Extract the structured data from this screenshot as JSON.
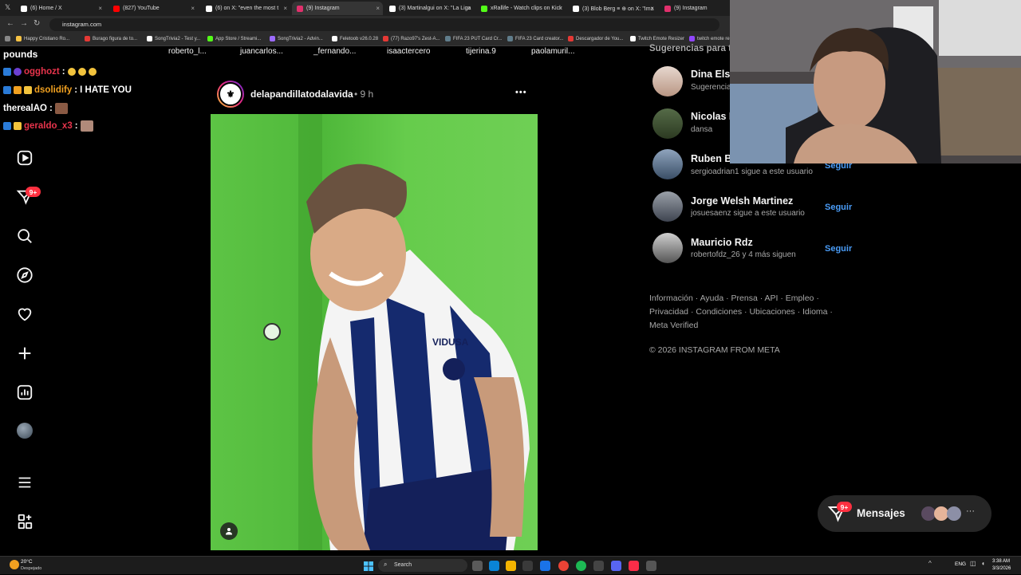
{
  "browser": {
    "tabs": [
      {
        "title": "(6) Home / X",
        "icon": "x-icon",
        "color": "#ffffff"
      },
      {
        "title": "(827) YouTube",
        "icon": "youtube-icon",
        "color": "#ff0000"
      },
      {
        "title": "(6) on X: \"even the most t",
        "icon": "x-icon",
        "color": "#ffffff"
      },
      {
        "title": "(9) Instagram",
        "icon": "instagram-icon",
        "color": "#e1306c"
      },
      {
        "title": "(3) Martinalgui on X: \"La Liga",
        "icon": "x-icon",
        "color": "#ffffff"
      },
      {
        "title": "xRallife - Watch clips on Kick",
        "icon": "kick-icon",
        "color": "#53fc18"
      },
      {
        "title": "(3) Blob Berg ≡ ⊕ on X: \"Ima",
        "icon": "x-icon",
        "color": "#ffffff"
      },
      {
        "title": "(9) Instagram",
        "icon": "instagram-icon",
        "color": "#e1306c"
      }
    ],
    "url": "instagram.com",
    "bookmarks": [
      "Happy Cristiano Ro...",
      "Burago figura de to...",
      "SongTrivia2 - Test y...",
      "App Store / Streami...",
      "SongTrivia2 - Advin...",
      "Feletoob v26.0.28",
      "(77) Razo97's Zest-A...",
      "FIFA 23 PUT Card Cr...",
      "FIFA 23 Card creator...",
      "Descargador de You...",
      "Twitch Emote Resizer",
      "twitch emote re..."
    ]
  },
  "chat": {
    "header": "pounds",
    "messages": [
      {
        "user": "ogghozt",
        "color": "#e8344c",
        "text": ""
      },
      {
        "user": "dsolidify",
        "color": "#f0a020",
        "text": "I HATE YOU"
      },
      {
        "user": "therealAO",
        "color": "#ffffff",
        "text": ""
      },
      {
        "user": "geraldo_x3",
        "color": "#e8344c",
        "text": ""
      }
    ]
  },
  "nav": {
    "notification_count": "9+",
    "icons": [
      "reels-icon",
      "messages-icon",
      "search-icon",
      "explore-icon",
      "heart-icon",
      "create-icon",
      "insights-icon",
      "profile-avatar",
      "menu-icon",
      "apps-icon"
    ]
  },
  "stories": [
    "roberto_l...",
    "juancarlos...",
    "_fernando...",
    "isaactercero",
    "tijerina.9",
    "paolamuril..."
  ],
  "post": {
    "username": "delapandillatodalavida",
    "time": "• 9 h",
    "more": "•••",
    "jersey_text": "VIDUSA"
  },
  "suggestions": {
    "title": "Sugerencias para ti",
    "items": [
      {
        "name": "Dina Elsh",
        "sub": "Sugerencias para ti",
        "follow": ""
      },
      {
        "name": "Nicolas F",
        "sub": "dansa",
        "follow": ""
      },
      {
        "name": "Ruben B",
        "sub": "sergioadrian1 sigue a este usuario",
        "follow": "Seguir"
      },
      {
        "name": "Jorge Welsh Martinez",
        "sub": "josuesaenz sigue a este usuario",
        "follow": "Seguir"
      },
      {
        "name": "Mauricio Rdz",
        "sub": "robertofdz_26 y 4 más siguen",
        "follow": "Seguir"
      }
    ]
  },
  "footer": {
    "line1": "Información · Ayuda · Prensa · API · Empleo ·",
    "line2": "Privacidad · Condiciones · Ubicaciones · Idioma ·",
    "line3": "Meta Verified",
    "copyright": "© 2026 INSTAGRAM FROM META"
  },
  "messages_button": {
    "label": "Mensajes",
    "count": "9+"
  },
  "taskbar": {
    "weather_temp": "20°C",
    "weather_desc": "Despejado",
    "search": "Search",
    "lang": "ENG",
    "time": "3:38 AM",
    "date": "3/3/2026"
  },
  "colors": {
    "accent": "#4a9df8",
    "notification": "#ff3040",
    "background": "#000000"
  }
}
